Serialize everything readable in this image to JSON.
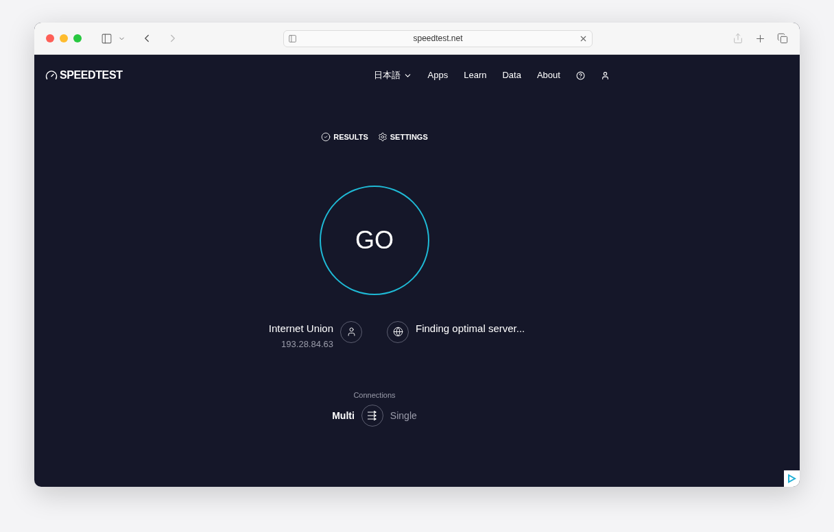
{
  "browser": {
    "url": "speedtest.net"
  },
  "header": {
    "logo": "SPEEDTEST",
    "language": "日本語",
    "nav": [
      "Apps",
      "Learn",
      "Data",
      "About"
    ]
  },
  "tools": [
    {
      "kind": "results",
      "label": "RESULTS"
    },
    {
      "kind": "settings",
      "label": "SETTINGS"
    }
  ],
  "go_button": "GO",
  "provider": {
    "name": "Internet Union",
    "ip": "193.28.84.63"
  },
  "server": {
    "status": "Finding optimal server..."
  },
  "connections": {
    "label": "Connections",
    "options": [
      {
        "label": "Multi",
        "selected": true
      },
      {
        "label": "Single",
        "selected": false
      }
    ]
  }
}
